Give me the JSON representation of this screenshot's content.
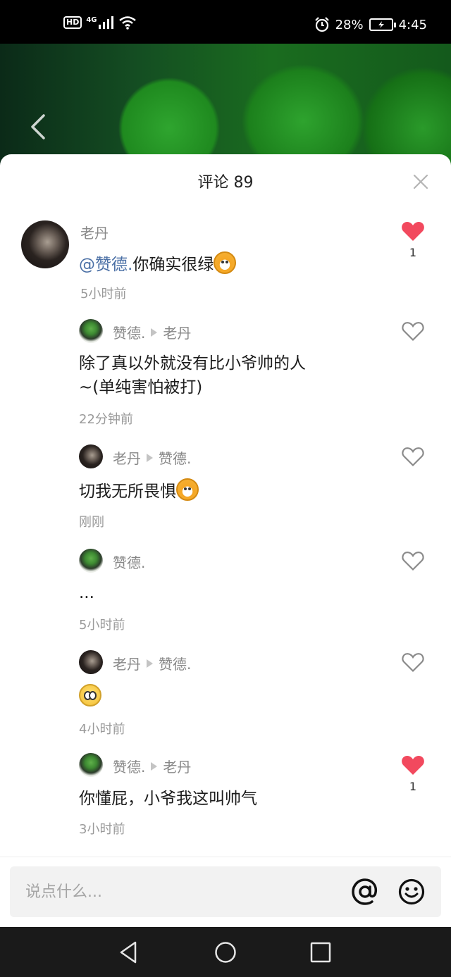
{
  "status_bar": {
    "network_badge": "HD",
    "network_type": "4G",
    "battery_percent": "28%",
    "time": "4:45"
  },
  "sheet": {
    "title": "评论 89",
    "input_placeholder": "说点什么..."
  },
  "comments": [
    {
      "name": "老丹",
      "reply_to": "",
      "mention": "@赞德.",
      "text": "你确实很绿",
      "emoji": "dog-emoji",
      "time": "5小时前",
      "liked": true,
      "like_count": "1"
    },
    {
      "name": "赞德.",
      "reply_to": "老丹",
      "text_line1": "除了真以外就没有比小爷帅的人",
      "text_line2": "~(单纯害怕被打)",
      "time": "22分钟前",
      "liked": false
    },
    {
      "name": "老丹",
      "reply_to": "赞德.",
      "text": "切我无所畏惧",
      "emoji": "dog-emoji",
      "time": "刚刚",
      "liked": false
    },
    {
      "name": "赞德.",
      "reply_to": "",
      "text": "...",
      "time": "5小时前",
      "liked": false
    },
    {
      "name": "老丹",
      "reply_to": "赞德.",
      "text": "",
      "emoji": "scared-emoji",
      "time": "4小时前",
      "liked": false
    },
    {
      "name": "赞德.",
      "reply_to": "老丹",
      "text": "你懂屁，小爷我这叫帅气",
      "time": "3小时前",
      "liked": true,
      "like_count": "1"
    }
  ],
  "colors": {
    "like_red": "#f2495e",
    "mention_blue": "#4a6fa5",
    "meta_gray": "#888888"
  }
}
